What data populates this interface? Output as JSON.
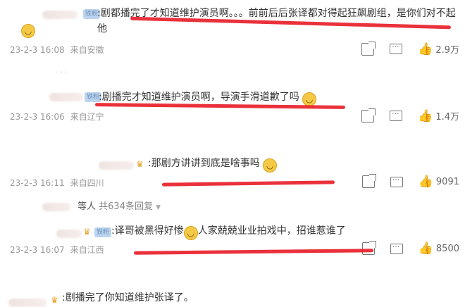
{
  "comments": [
    {
      "text": ":剧都播完了才知道维护演员啊。。。前前后后张译都对得起狂飙剧组，是你们对不起他",
      "time": "23-2-3 16:08",
      "location": "来自安徽",
      "likes": "2.9万"
    },
    {
      "text": ":剧播完才知道维护演员啊，导演手滑道歉了吗",
      "time": "23-2-3 16:06",
      "location": "来自辽宁",
      "likes": "1.4万"
    },
    {
      "text": ":那剧方讲讲到底是啥事吗",
      "time": "23-2-3 16:11",
      "location": "来自四川",
      "likes": "9091",
      "replies_prefix": "等人",
      "replies_count": "共634条回复"
    },
    {
      "text_a": ":译哥被黑得好惨",
      "text_b": "人家兢兢业业拍戏中，招谁惹谁了",
      "time": "23-2-3 16:07",
      "location": "来自江西",
      "likes": "8500"
    },
    {
      "text": ":剧播完了你知道维护张译了。"
    }
  ],
  "colors": {
    "underline": "#e8202a",
    "meta": "#999999",
    "badge": "#bcd4ef"
  }
}
